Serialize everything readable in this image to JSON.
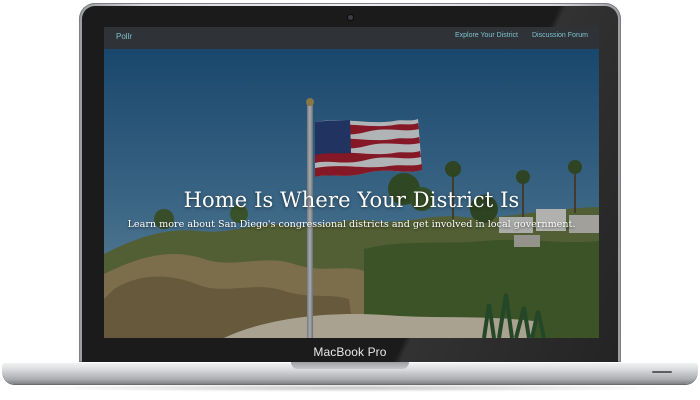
{
  "device": {
    "model_label": "MacBook Pro"
  },
  "navbar": {
    "brand": "Pollr",
    "links": [
      {
        "label": "Explore Your District"
      },
      {
        "label": "Discussion Forum"
      }
    ]
  },
  "hero": {
    "title": "Home Is Where Your District Is",
    "subtitle": "Learn more about San Diego's congressional districts and get involved in local government."
  },
  "colors": {
    "navbar_bg": "#2f3337",
    "nav_link": "#7ec0cf",
    "hero_text": "#ffffff",
    "bezel": "#1b1b1c"
  }
}
